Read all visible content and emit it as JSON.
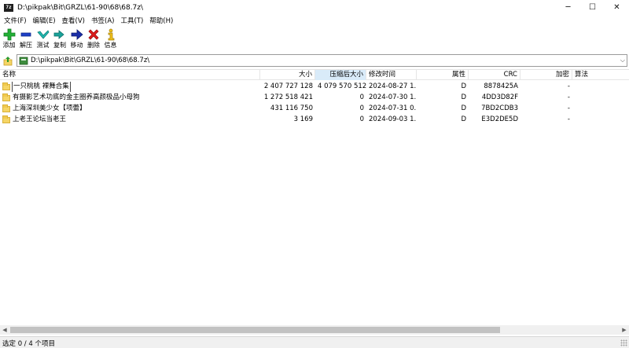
{
  "window": {
    "icon_text": "7z",
    "title": "D:\\pikpak\\Bit\\GRZL\\61-90\\68\\68.7z\\",
    "minimize": "─",
    "maximize": "☐",
    "close": "✕"
  },
  "menu": [
    "文件(F)",
    "编辑(E)",
    "查看(V)",
    "书签(A)",
    "工具(T)",
    "帮助(H)"
  ],
  "toolbar": {
    "add": "添加",
    "extract": "解压",
    "test": "测试",
    "copy": "复制",
    "move": "移动",
    "delete": "删除",
    "info": "信息"
  },
  "address": {
    "path": "D:\\pikpak\\Bit\\GRZL\\61-90\\68\\68.7z\\",
    "dropdown": "⌵"
  },
  "columns": {
    "name": "名称",
    "size": "大小",
    "packed": "压缩后大小",
    "modified": "修改时间",
    "attr": "属性",
    "crc": "CRC",
    "encrypted": "加密",
    "method": "算法"
  },
  "rows": [
    {
      "name": "一只桃桃 裸舞合集",
      "size": "2 407 727 128",
      "packed": "4 079 570 512",
      "modified": "2024-08-27 1...",
      "attr": "D",
      "crc": "8878425A",
      "encrypted": "-"
    },
    {
      "name": "有摄影艺术功底的金主圈养高颜极品小母狗",
      "size": "1 272 518 421",
      "packed": "0",
      "modified": "2024-07-30 1...",
      "attr": "D",
      "crc": "4DD3D82F",
      "encrypted": "-"
    },
    {
      "name": "上海深圳美少女【项蕾】",
      "size": "431 116 750",
      "packed": "0",
      "modified": "2024-07-31 0...",
      "attr": "D",
      "crc": "7BD2CDB3",
      "encrypted": "-"
    },
    {
      "name": "上老王论坛当老王",
      "size": "3 169",
      "packed": "0",
      "modified": "2024-09-03 1...",
      "attr": "D",
      "crc": "E3D2DE5D",
      "encrypted": "-"
    }
  ],
  "scrollbar": {
    "left": "◀",
    "right": "▶"
  },
  "status": {
    "text": "选定 0 / 4 个项目"
  }
}
